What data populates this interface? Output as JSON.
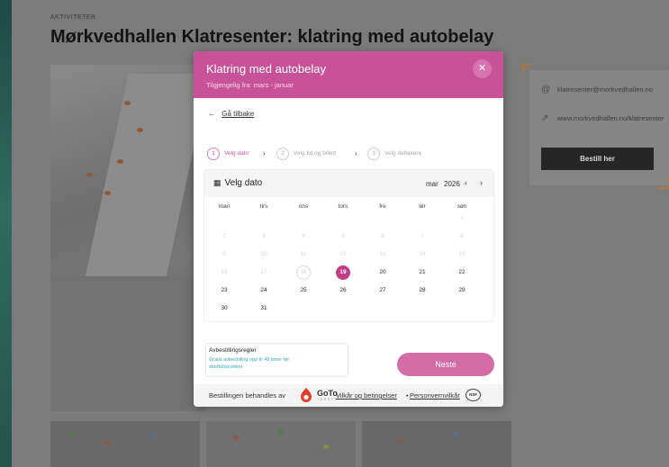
{
  "page": {
    "eyebrow": "AKTIVITETER",
    "title": "Mørkvedhallen Klatresenter: klatring med autobelay"
  },
  "contact": {
    "email_icon": "at-icon",
    "email": "klatresenter@morkvedhallen.no",
    "web_icon": "share-arrow-icon",
    "website": "www.morkvedhallen.no/klatresenter",
    "book_label": "Bestill her"
  },
  "modal": {
    "title": "Klatring med autobelay",
    "subtitle": "Tilgjengelig fra: mars - januar",
    "close": "✕",
    "back_label": "Gå tilbake",
    "steps": [
      {
        "num": "1",
        "label": "Velg dato",
        "active": true
      },
      {
        "num": "2",
        "label": "Velg tid og billett",
        "active": false
      },
      {
        "num": "3",
        "label": "Velg deltakere",
        "active": false
      }
    ],
    "calendar": {
      "title": "Velg dato",
      "month": "mar",
      "year": "2026",
      "weekdays": [
        "man",
        "tirs",
        "ons",
        "tors",
        "fre",
        "lør",
        "søn"
      ],
      "weeks": [
        [
          "",
          "",
          "",
          "",
          "",
          "",
          "1"
        ],
        [
          "2",
          "3",
          "4",
          "5",
          "6",
          "7",
          "8"
        ],
        [
          "9",
          "10",
          "11",
          "12",
          "13",
          "14",
          "15"
        ],
        [
          "16",
          "17",
          "18",
          "19",
          "20",
          "21",
          "22"
        ],
        [
          "23",
          "24",
          "25",
          "26",
          "27",
          "28",
          "29"
        ],
        [
          "30",
          "31",
          "",
          "",
          "",
          "",
          ""
        ]
      ],
      "first_available_day": 19,
      "today_day": 18,
      "selected_day": 19
    },
    "policy": {
      "title": "Avbestillingsregler",
      "text": "Gratis avbestilling opp til 48 timer før starttidspunktet"
    },
    "next_label": "Neste",
    "footer": {
      "processed_by": "Bestillingen behandles av",
      "goto_word": "GoTo",
      "goto_sub": "I D R E T T",
      "terms": "Vilkår og betingelser",
      "separator": "•",
      "privacy": "Personvernvilkår",
      "nsf_badge": "NSF"
    }
  },
  "colors": {
    "accent": "#c85298",
    "selected": "#c03f86",
    "policy_text": "#3aa7b0",
    "book_button": "#262626"
  }
}
